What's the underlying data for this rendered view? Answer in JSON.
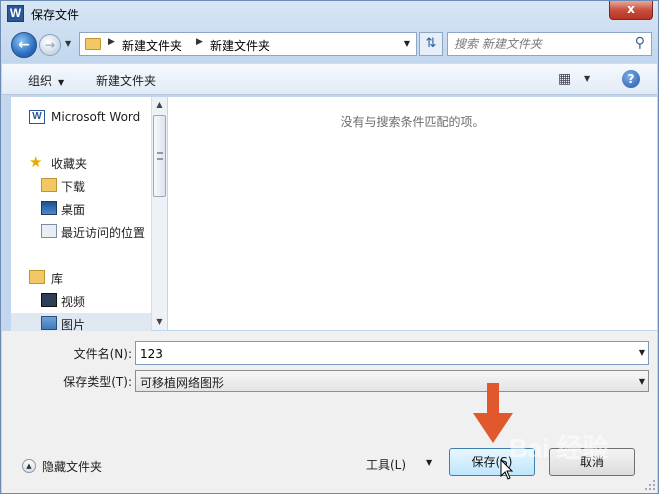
{
  "window": {
    "title": "保存文件",
    "app_icon_letter": "W",
    "close_label": "x"
  },
  "navbar": {
    "breadcrumbs": [
      "新建文件夹",
      "新建文件夹"
    ],
    "search_placeholder": "搜索 新建文件夹"
  },
  "toolbar": {
    "organize": "组织",
    "new_folder": "新建文件夹"
  },
  "navpane": {
    "items": [
      {
        "label": "Microsoft Word",
        "icon": "word-icon"
      },
      {
        "label": "收藏夹",
        "icon": "star-icon"
      },
      {
        "label": "下载",
        "icon": "download-folder-icon"
      },
      {
        "label": "桌面",
        "icon": "desktop-icon"
      },
      {
        "label": "最近访问的位置",
        "icon": "recent-places-icon"
      },
      {
        "label": "库",
        "icon": "library-icon"
      },
      {
        "label": "视频",
        "icon": "video-icon"
      },
      {
        "label": "图片",
        "icon": "pictures-icon"
      }
    ]
  },
  "content": {
    "empty_message": "没有与搜索条件匹配的项。"
  },
  "form": {
    "filename_label": "文件名(N):",
    "filename_value": "123",
    "filetype_label": "保存类型(T):",
    "filetype_value": "可移植网络图形"
  },
  "footer": {
    "hide_folders": "隐藏文件夹",
    "tools": "工具(L)",
    "save": "保存(S)",
    "cancel": "取消"
  },
  "watermark": "Bai 经验",
  "colors": {
    "accent_arrow": "#e0582b",
    "close_red": "#c74f3e"
  }
}
